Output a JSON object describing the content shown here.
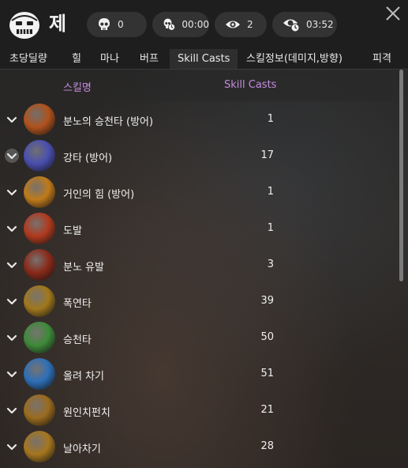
{
  "header": {
    "class_icon": "mask-icon",
    "char_name": "제",
    "stats": [
      {
        "icon": "skull-icon",
        "value": "0"
      },
      {
        "icon": "skull-clock-icon",
        "value": "00:00"
      },
      {
        "icon": "eye-icon",
        "value": "2"
      },
      {
        "icon": "eye-clock-icon",
        "value": "03:52"
      }
    ],
    "close_icon": "close-icon"
  },
  "tabs": [
    {
      "label": "초당딜량"
    },
    {
      "label": "힐"
    },
    {
      "label": "마나"
    },
    {
      "label": "버프"
    },
    {
      "label": "Skill Casts",
      "active": true
    },
    {
      "label": "스킬정보(데미지,방향)"
    },
    {
      "label": "피격"
    }
  ],
  "table": {
    "col_name": "스킬명",
    "col_casts": "Skill Casts",
    "rows": [
      {
        "name": "분노의 승천타 (방어)",
        "casts": "1",
        "color": "#b0521d"
      },
      {
        "name": "강타 (방어)",
        "casts": "17",
        "color": "#4a4fb0"
      },
      {
        "name": "거인의 힘 (방어)",
        "casts": "1",
        "color": "#c07a1a"
      },
      {
        "name": "도발",
        "casts": "1",
        "color": "#b03a1e"
      },
      {
        "name": "분노 유발",
        "casts": "3",
        "color": "#8a2a1a"
      },
      {
        "name": "폭연타",
        "casts": "39",
        "color": "#a0781c"
      },
      {
        "name": "승천타",
        "casts": "50",
        "color": "#3e8a3a"
      },
      {
        "name": "올려 차기",
        "casts": "51",
        "color": "#2d6fb8"
      },
      {
        "name": "원인치펀치",
        "casts": "21",
        "color": "#9a6b1e"
      },
      {
        "name": "날아차기",
        "casts": "28",
        "color": "#a6761e"
      }
    ]
  },
  "colors": {
    "header_text": "#c58be0",
    "header_bg": "#1e1e1e"
  }
}
